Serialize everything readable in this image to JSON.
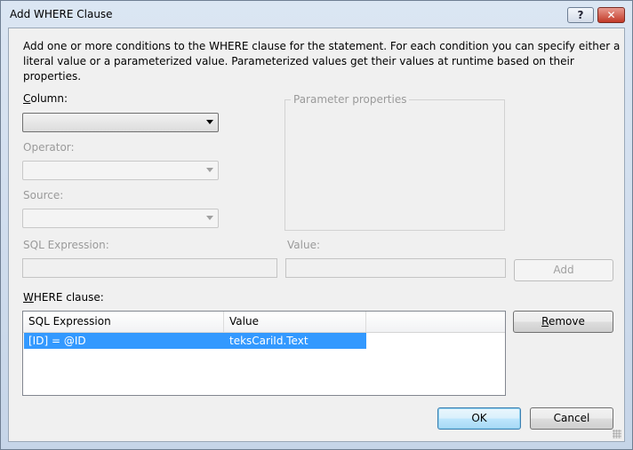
{
  "window": {
    "title": "Add WHERE Clause"
  },
  "titlebar": {
    "help_label": "?",
    "close_label": "✕"
  },
  "description": "Add one or more conditions to the WHERE clause for the statement. For each condition you can specify either a literal value or a parameterized value. Parameterized values get their values at runtime based on their properties.",
  "form": {
    "column_label_key": "C",
    "column_label_rest": "olumn:",
    "column_value": "",
    "operator_label": "Operator:",
    "source_label": "Source:",
    "sql_expression_label": "SQL Expression:",
    "value_label": "Value:",
    "parameter_properties_label": "Parameter properties",
    "add_label": "Add"
  },
  "where": {
    "label_key": "W",
    "label_rest": "HERE clause:",
    "columns": [
      "SQL Expression",
      "Value"
    ],
    "rows": [
      {
        "sql_expression": "[ID] = @ID",
        "value": "teksCariId.Text"
      }
    ],
    "remove_key": "R",
    "remove_rest": "emove"
  },
  "buttons": {
    "ok": "OK",
    "cancel": "Cancel"
  },
  "colors": {
    "selection": "#3399ff",
    "close_button": "#c23a28",
    "default_button_border": "#3c7fb1"
  }
}
